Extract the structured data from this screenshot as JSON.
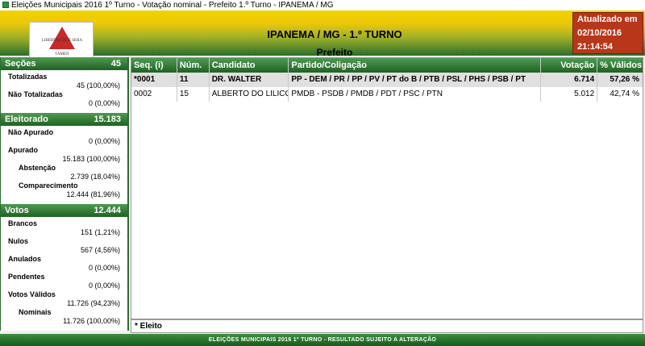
{
  "window": {
    "title": "Eleições Municipais 2016 1º Turno - Votação nominal - Prefeito 1.º Turno - IPANEMA / MG"
  },
  "logo": {
    "top_text": "LIBERTAS QUÆ SERA",
    "bottom_text": "TAMEN"
  },
  "header": {
    "title": "IPANEMA / MG - 1.º TURNO",
    "subtitle": "Prefeito"
  },
  "updated": {
    "label": "Atualizado em",
    "date": "02/10/2016",
    "time": "21:14:54"
  },
  "secoes": {
    "label": "Seções",
    "total": "45",
    "totalizadas_label": "Totalizadas",
    "totalizadas_value": "45 (100,00%)",
    "nao_totalizadas_label": "Não Totalizadas",
    "nao_totalizadas_value": "0 (0,00%)"
  },
  "eleitorado": {
    "label": "Eleitorado",
    "total": "15.183",
    "nao_apurado_label": "Não Apurado",
    "nao_apurado_value": "0 (0,00%)",
    "apurado_label": "Apurado",
    "apurado_value": "15.183 (100,00%)",
    "abstencao_label": "Abstenção",
    "abstencao_value": "2.739 (18,04%)",
    "comparecimento_label": "Comparecimento",
    "comparecimento_value": "12.444 (81,96%)"
  },
  "votos": {
    "label": "Votos",
    "total": "12.444",
    "brancos_label": "Brancos",
    "brancos_value": "151 (1,21%)",
    "nulos_label": "Nulos",
    "nulos_value": "567 (4,56%)",
    "anulados_label": "Anulados",
    "anulados_value": "0 (0,00%)",
    "pendentes_label": "Pendentes",
    "pendentes_value": "0 (0,00%)",
    "validos_label": "Votos Válidos",
    "validos_value": "11.726 (94,23%)",
    "nominais_label": "Nominais",
    "nominais_value": "11.726 (100,00%)"
  },
  "table": {
    "headers": {
      "seq": "Seq.  (i)",
      "num": "Núm.",
      "candidato": "Candidato",
      "partido": "Partido/Coligação",
      "votacao": "Votação",
      "validos": "% Válidos"
    },
    "rows": [
      {
        "seq": "*0001",
        "num": "11",
        "candidato": "DR. WALTER",
        "partido": "PP - DEM / PR / PP / PV / PT do B / PTB / PSL / PHS / PSB / PT",
        "votacao": "6.714",
        "validos": "57,26 %"
      },
      {
        "seq": "0002",
        "num": "15",
        "candidato": "ALBERTO DO LILICO",
        "partido": "PMDB - PSDB / PMDB / PDT / PSC / PTN",
        "votacao": "5.012",
        "validos": "42,74 %"
      }
    ]
  },
  "eleito_note": "* Eleito",
  "footer": "ELEIÇÕES MUNICIPAIS 2016 1º TURNO - RESULTADO SUJEITO A ALTERAÇÃO"
}
